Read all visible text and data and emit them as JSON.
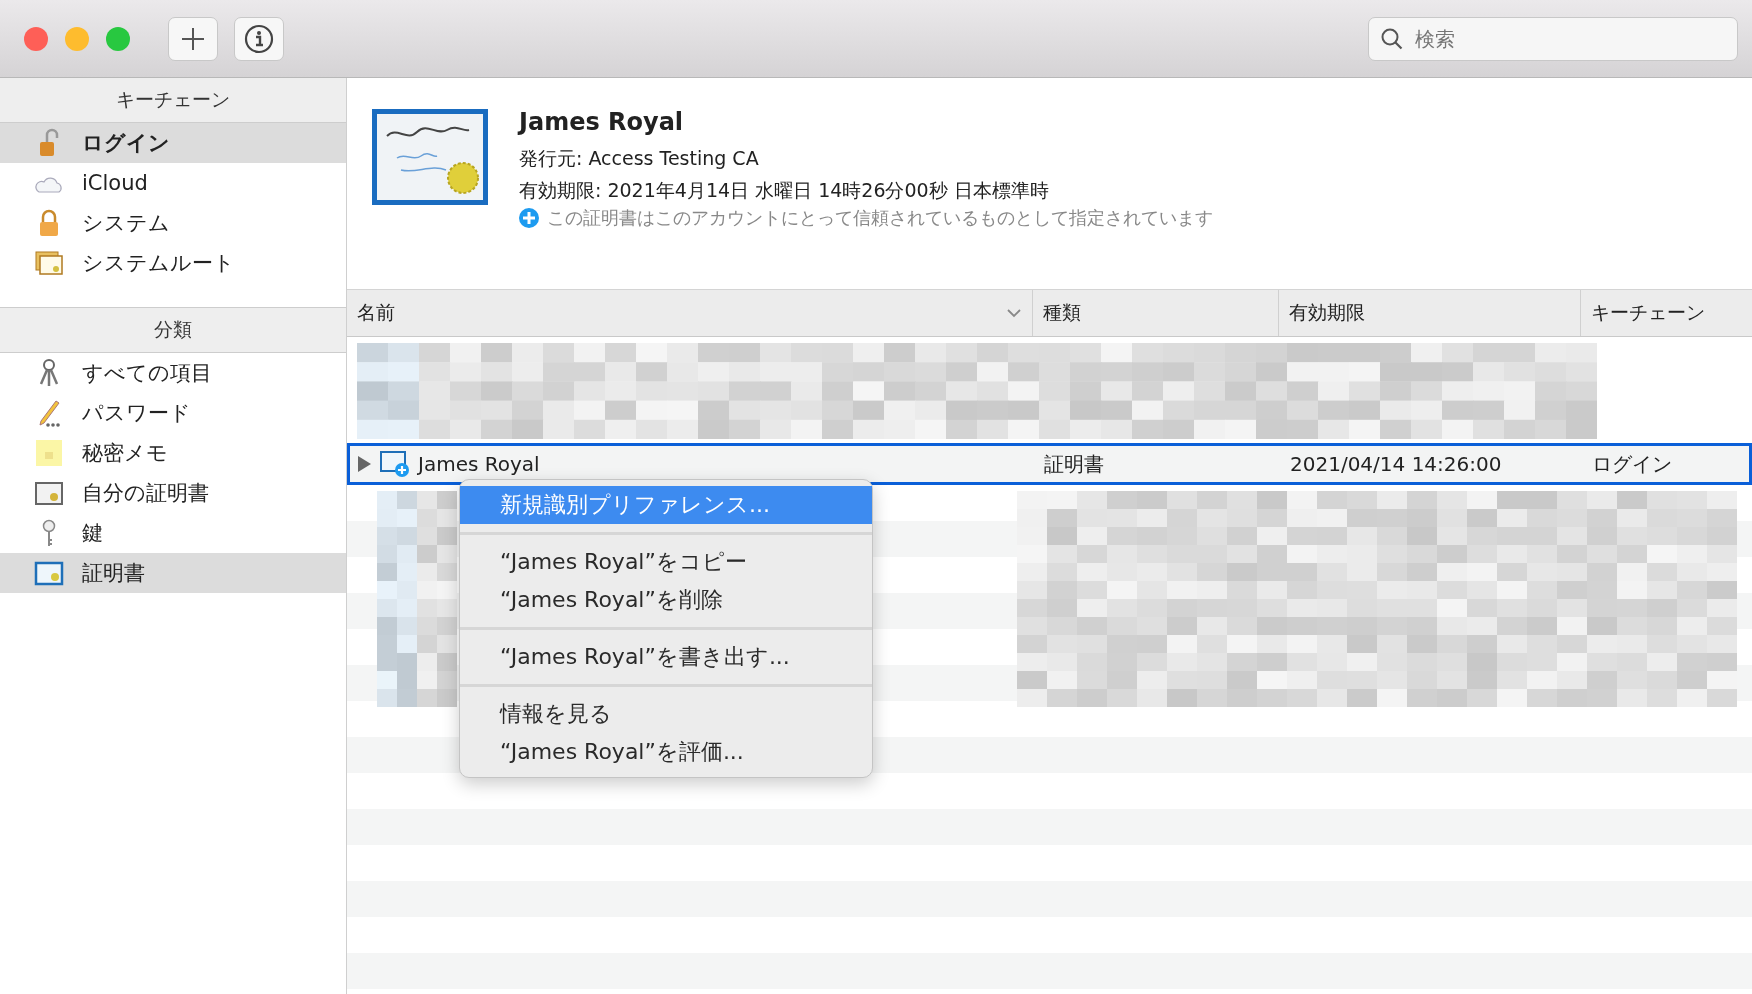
{
  "toolbar": {
    "search": {
      "placeholder": "検索"
    }
  },
  "sidebar": {
    "sections": [
      {
        "title": "キーチェーン",
        "items": [
          {
            "label": "ログイン",
            "selected": true
          },
          {
            "label": "iCloud",
            "selected": false
          },
          {
            "label": "システム",
            "selected": false
          },
          {
            "label": "システムルート",
            "selected": false
          }
        ]
      },
      {
        "title": "分類",
        "items": [
          {
            "label": "すべての項目",
            "selected": false
          },
          {
            "label": "パスワード",
            "selected": false
          },
          {
            "label": "秘密メモ",
            "selected": false
          },
          {
            "label": "自分の証明書",
            "selected": false
          },
          {
            "label": "鍵",
            "selected": false
          },
          {
            "label": "証明書",
            "selected": true
          }
        ]
      }
    ]
  },
  "details": {
    "title": "James Royal",
    "issuer": "発行元: Access Testing CA",
    "expires": "有効期限: 2021年4月14日 水曜日 14時26分00秒 日本標準時",
    "trust": "この証明書はこのアカウントにとって信頼されているものとして指定されています"
  },
  "table": {
    "columns": [
      {
        "label": "名前",
        "sorted": true
      },
      {
        "label": "種類",
        "sorted": false
      },
      {
        "label": "有効期限",
        "sorted": false
      },
      {
        "label": "キーチェーン",
        "sorted": false
      }
    ],
    "rows": [
      {
        "name": "James Royal",
        "kind": "証明書",
        "expires": "2021/04/14 14:26:00",
        "keychain": "ログイン",
        "selected": true,
        "expanded": false
      }
    ]
  },
  "context_menu": [
    {
      "kind": "item",
      "label": "新規識別プリファレンス...",
      "selected": true
    },
    {
      "kind": "separator"
    },
    {
      "kind": "item",
      "label": "“James Royal”をコピー",
      "selected": false
    },
    {
      "kind": "item",
      "label": "“James Royal”を削除",
      "selected": false
    },
    {
      "kind": "separator"
    },
    {
      "kind": "item",
      "label": "“James Royal”を書き出す...",
      "selected": false
    },
    {
      "kind": "separator"
    },
    {
      "kind": "item",
      "label": "情報を見る",
      "selected": false
    },
    {
      "kind": "item",
      "label": "“James Royal”を評価...",
      "selected": false
    }
  ]
}
